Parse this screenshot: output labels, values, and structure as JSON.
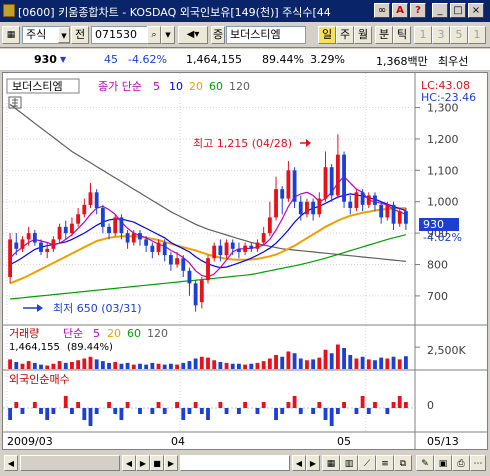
{
  "window": {
    "title": "[0600] 키움종합차트 - KOSDAQ 외국인보유[149(천)] 주식수[44"
  },
  "toolbar": {
    "market": "주식",
    "code": "071530",
    "period_short": "전",
    "stock_prefix": "증",
    "stock_name": "보더스티엠",
    "btn_day": "일",
    "btn_week": "주",
    "btn_month": "월",
    "btn_min": "분",
    "btn_tick": "틱",
    "num_1": "1",
    "num_3": "3",
    "num_5": "5",
    "num_1b": "1"
  },
  "info": {
    "price": "930",
    "change": "45",
    "change_pct": "-4.62%",
    "volume": "1,464,155",
    "ratio": "89.44%",
    "turnover": "3.29%",
    "amount": "1,368백만",
    "user": "최우선"
  },
  "legend": {
    "stock": "보더스티엠",
    "ma_label": "종가 단순",
    "ma5": "5",
    "ma10": "10",
    "ma20": "20",
    "ma60": "60",
    "ma120": "120",
    "lc": "LC:43.08",
    "hc": "HC:-23.46"
  },
  "colors": {
    "up": "#e8101b",
    "down": "#1c3fd6",
    "ma5": "#c000c0",
    "ma10": "#0000ff",
    "ma20": "#f0a000",
    "ma60": "#00a000",
    "ma120": "#606060"
  },
  "annotations": {
    "high": "최고 1,215 (04/28)",
    "low": "최저 650 (03/31)"
  },
  "price_axis": {
    "ticks": [
      "1,300",
      "1,200",
      "1,100",
      "1,000",
      "900",
      "800",
      "700"
    ],
    "current": "930",
    "current_pct": "-4.62%"
  },
  "volume_panel": {
    "title": "거래량",
    "ma_label": "단순",
    "ma5": "5",
    "ma20": "20",
    "ma60": "60",
    "ma120": "120",
    "value": "1,464,155",
    "pct": "(89.44%)",
    "axis": "2,500K"
  },
  "foreign_panel": {
    "title": "외국인순매수",
    "axis": "0"
  },
  "date_axis": [
    "2009/03",
    "04",
    "05",
    "05/13"
  ],
  "chart_data": {
    "type": "candlestick",
    "price_ylim": [
      620,
      1340
    ],
    "candles": [
      [
        760,
        880,
        740,
        900,
        1
      ],
      [
        870,
        850,
        830,
        900,
        0
      ],
      [
        850,
        880,
        840,
        890,
        1
      ],
      [
        880,
        900,
        860,
        920,
        1
      ],
      [
        900,
        870,
        860,
        910,
        0
      ],
      [
        870,
        840,
        830,
        880,
        0
      ],
      [
        840,
        850,
        820,
        870,
        1
      ],
      [
        850,
        880,
        840,
        890,
        1
      ],
      [
        880,
        920,
        870,
        930,
        1
      ],
      [
        920,
        900,
        880,
        940,
        0
      ],
      [
        900,
        930,
        890,
        950,
        1
      ],
      [
        930,
        960,
        920,
        980,
        1
      ],
      [
        960,
        990,
        950,
        1010,
        1
      ],
      [
        990,
        1030,
        980,
        1060,
        1
      ],
      [
        1030,
        980,
        960,
        1040,
        0
      ],
      [
        980,
        920,
        900,
        990,
        0
      ],
      [
        920,
        900,
        880,
        930,
        0
      ],
      [
        900,
        950,
        890,
        960,
        1
      ],
      [
        950,
        900,
        880,
        960,
        0
      ],
      [
        900,
        870,
        850,
        910,
        0
      ],
      [
        870,
        900,
        860,
        910,
        1
      ],
      [
        900,
        880,
        860,
        910,
        0
      ],
      [
        880,
        860,
        840,
        890,
        0
      ],
      [
        860,
        840,
        820,
        870,
        0
      ],
      [
        840,
        870,
        830,
        880,
        1
      ],
      [
        870,
        830,
        810,
        880,
        0
      ],
      [
        830,
        800,
        780,
        840,
        0
      ],
      [
        800,
        820,
        790,
        840,
        1
      ],
      [
        820,
        780,
        760,
        830,
        0
      ],
      [
        780,
        740,
        700,
        790,
        0
      ],
      [
        740,
        670,
        650,
        750,
        0
      ],
      [
        680,
        750,
        660,
        760,
        1
      ],
      [
        750,
        820,
        740,
        830,
        1
      ],
      [
        820,
        860,
        810,
        870,
        1
      ],
      [
        860,
        830,
        810,
        880,
        0
      ],
      [
        830,
        870,
        820,
        880,
        1
      ],
      [
        870,
        850,
        830,
        880,
        0
      ],
      [
        850,
        840,
        820,
        870,
        0
      ],
      [
        840,
        860,
        830,
        870,
        1
      ],
      [
        860,
        850,
        840,
        870,
        0
      ],
      [
        850,
        870,
        840,
        880,
        1
      ],
      [
        870,
        900,
        860,
        920,
        1
      ],
      [
        900,
        950,
        890,
        1000,
        1
      ],
      [
        950,
        1040,
        940,
        1080,
        1
      ],
      [
        1040,
        1010,
        960,
        1050,
        0
      ],
      [
        1010,
        1100,
        1000,
        1130,
        1
      ],
      [
        1100,
        1000,
        980,
        1110,
        0
      ],
      [
        1000,
        960,
        940,
        1020,
        0
      ],
      [
        960,
        1000,
        950,
        1010,
        1
      ],
      [
        1000,
        960,
        940,
        1010,
        0
      ],
      [
        960,
        1010,
        950,
        1030,
        1
      ],
      [
        1010,
        1110,
        1000,
        1160,
        1
      ],
      [
        1110,
        1020,
        1000,
        1120,
        0
      ],
      [
        1020,
        1150,
        1010,
        1215,
        1
      ],
      [
        1150,
        1000,
        980,
        1160,
        0
      ],
      [
        1000,
        980,
        960,
        1020,
        0
      ],
      [
        980,
        1030,
        970,
        1040,
        1
      ],
      [
        1030,
        990,
        970,
        1040,
        0
      ],
      [
        990,
        1020,
        980,
        1030,
        1
      ],
      [
        1020,
        990,
        970,
        1030,
        0
      ],
      [
        990,
        950,
        930,
        1000,
        0
      ],
      [
        950,
        990,
        940,
        1000,
        1
      ],
      [
        990,
        930,
        910,
        1000,
        0
      ],
      [
        930,
        970,
        920,
        980,
        1
      ],
      [
        970,
        930,
        910,
        980,
        0
      ]
    ],
    "ma5": [
      820,
      840,
      855,
      870,
      880,
      875,
      870,
      862,
      868,
      880,
      895,
      915,
      935,
      960,
      980,
      985,
      975,
      960,
      935,
      915,
      900,
      892,
      885,
      875,
      865,
      858,
      845,
      835,
      822,
      805,
      780,
      765,
      760,
      770,
      790,
      815,
      840,
      850,
      850,
      852,
      855,
      862,
      880,
      910,
      945,
      985,
      1015,
      1025,
      1030,
      1020,
      1000,
      1010,
      1030,
      1060,
      1080,
      1060,
      1040,
      1030,
      1005,
      1000,
      995,
      990,
      975,
      968,
      960
    ],
    "ma10": [
      800,
      810,
      822,
      835,
      848,
      855,
      860,
      864,
      868,
      872,
      880,
      890,
      900,
      912,
      925,
      935,
      942,
      945,
      945,
      940,
      935,
      925,
      915,
      905,
      895,
      885,
      870,
      860,
      850,
      840,
      825,
      812,
      802,
      795,
      790,
      792,
      798,
      805,
      812,
      820,
      830,
      840,
      852,
      868,
      888,
      910,
      935,
      955,
      970,
      980,
      985,
      995,
      1005,
      1015,
      1020,
      1025,
      1022,
      1018,
      1012,
      1008,
      1000,
      992,
      985,
      978,
      972
    ],
    "ma20": [
      740,
      748,
      756,
      765,
      775,
      785,
      795,
      805,
      815,
      825,
      835,
      845,
      855,
      865,
      875,
      880,
      885,
      888,
      890,
      890,
      890,
      888,
      885,
      882,
      878,
      872,
      866,
      860,
      855,
      850,
      845,
      838,
      832,
      826,
      822,
      818,
      816,
      815,
      815,
      816,
      818,
      822,
      826,
      832,
      840,
      850,
      860,
      872,
      884,
      896,
      908,
      920,
      930,
      940,
      948,
      955,
      960,
      965,
      968,
      972,
      975,
      977,
      978,
      979,
      980
    ],
    "ma60": [
      690,
      692,
      694,
      696,
      698,
      700,
      702,
      704,
      706,
      708,
      710,
      712,
      714,
      716,
      718,
      720,
      722,
      724,
      726,
      728,
      730,
      732,
      734,
      736,
      738,
      740,
      742,
      744,
      746,
      748,
      750,
      752,
      754,
      756,
      758,
      760,
      762,
      764,
      766,
      768,
      772,
      776,
      780,
      784,
      788,
      792,
      796,
      800,
      805,
      810,
      815,
      820,
      826,
      832,
      838,
      844,
      850,
      856,
      862,
      868,
      874,
      880,
      885,
      890,
      895
    ],
    "ma120": [
      1310,
      1295,
      1280,
      1265,
      1250,
      1235,
      1220,
      1205,
      1190,
      1175,
      1160,
      1148,
      1136,
      1124,
      1112,
      1100,
      1088,
      1076,
      1064,
      1052,
      1040,
      1028,
      1016,
      1004,
      992,
      980,
      968,
      958,
      948,
      938,
      928,
      920,
      912,
      906,
      900,
      894,
      888,
      882,
      876,
      870,
      866,
      862,
      858,
      854,
      850,
      848,
      846,
      844,
      842,
      840,
      838,
      836,
      834,
      832,
      830,
      828,
      826,
      824,
      822,
      820,
      818,
      816,
      814,
      812,
      810
    ],
    "volume": [
      1.1,
      0.8,
      0.6,
      0.9,
      0.7,
      0.5,
      0.4,
      0.6,
      0.9,
      0.7,
      0.8,
      1.0,
      1.2,
      1.4,
      1.1,
      0.9,
      0.7,
      0.8,
      0.6,
      0.7,
      0.5,
      0.6,
      0.5,
      0.7,
      0.6,
      0.5,
      0.6,
      0.5,
      0.7,
      0.9,
      1.2,
      1.4,
      1.3,
      1.0,
      0.8,
      0.7,
      0.6,
      0.6,
      0.5,
      0.6,
      0.7,
      0.9,
      1.2,
      1.6,
      1.4,
      2.0,
      1.8,
      1.2,
      1.0,
      1.1,
      1.3,
      2.2,
      1.8,
      2.8,
      2.4,
      1.6,
      1.2,
      1.4,
      1.1,
      1.0,
      1.3,
      1.2,
      1.4,
      1.1,
      1.46
    ],
    "volume_ylim": [
      0,
      3.2
    ],
    "foreign": [
      -2,
      1,
      -1,
      0,
      1,
      -1,
      -2,
      -1,
      0,
      2,
      -1,
      1,
      -2,
      -3,
      -1,
      0,
      1,
      -1,
      -2,
      1,
      0,
      -1,
      0,
      -1,
      1,
      -1,
      0,
      1,
      -2,
      -1,
      1,
      -1,
      -2,
      0,
      1,
      -1,
      0,
      -1,
      1,
      0,
      -1,
      1,
      0,
      -2,
      -1,
      1,
      2,
      -1,
      0,
      -1,
      1,
      -2,
      -3,
      -1,
      1,
      0,
      -1,
      2,
      -1,
      1,
      0,
      -1,
      1,
      2,
      1
    ],
    "foreign_ylim": [
      -3.5,
      3.5
    ]
  }
}
